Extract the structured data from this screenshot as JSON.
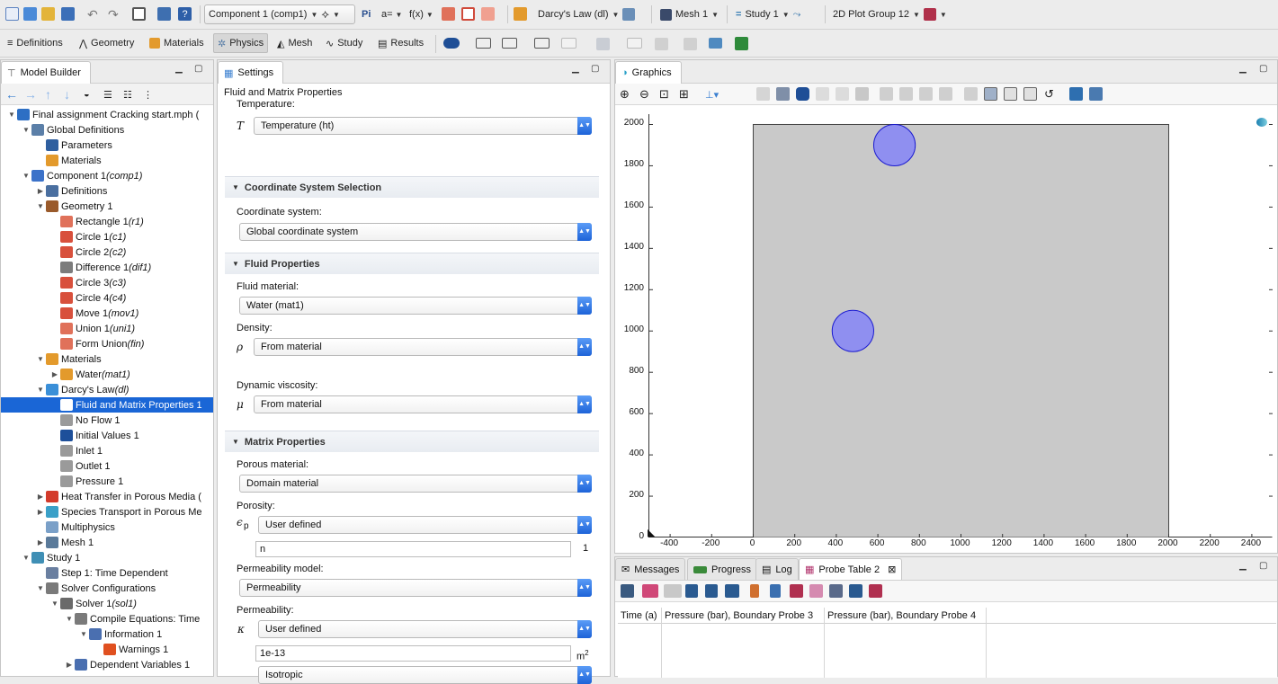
{
  "toolbar": {
    "component_combo": "Component 1 (comp1)",
    "param_label": "Pi",
    "aeq_label": "a=",
    "fx_label": "f(x)",
    "physics_combo": "Darcy's Law (dl)",
    "mesh_combo": "Mesh 1",
    "study_combo": "Study 1",
    "plot_combo": "2D Plot Group 12"
  },
  "ribbon": {
    "tabs": [
      "Definitions",
      "Geometry",
      "Materials",
      "Physics",
      "Mesh",
      "Study",
      "Results"
    ],
    "active_tab": "Physics"
  },
  "model_builder": {
    "title": "Model Builder",
    "tree": [
      {
        "label": "Final assignment Cracking start.mph (",
        "tag": "",
        "level": 0,
        "tw": "▼",
        "icon": "#2d6fc4"
      },
      {
        "label": "Global Definitions",
        "tag": "",
        "level": 1,
        "tw": "▼",
        "icon": "#5b7fa8"
      },
      {
        "label": "Parameters",
        "tag": "",
        "level": 2,
        "tw": "",
        "icon": "#2f5f9f"
      },
      {
        "label": "Materials",
        "tag": "",
        "level": 2,
        "tw": "",
        "icon": "#e39a2c"
      },
      {
        "label": "Component 1 ",
        "tag": "(comp1)",
        "level": 1,
        "tw": "▼",
        "icon": "#3b72c9"
      },
      {
        "label": "Definitions",
        "tag": "",
        "level": 2,
        "tw": "▶",
        "icon": "#4a6fa0"
      },
      {
        "label": "Geometry 1",
        "tag": "",
        "level": 2,
        "tw": "▼",
        "icon": "#9a5a2b"
      },
      {
        "label": "Rectangle 1 ",
        "tag": "(r1)",
        "level": 3,
        "tw": "",
        "icon": "#e0715a"
      },
      {
        "label": "Circle 1 ",
        "tag": "(c1)",
        "level": 3,
        "tw": "",
        "icon": "#d8503c"
      },
      {
        "label": "Circle 2 ",
        "tag": "(c2)",
        "level": 3,
        "tw": "",
        "icon": "#d8503c"
      },
      {
        "label": "Difference 1 ",
        "tag": "(dif1)",
        "level": 3,
        "tw": "",
        "icon": "#7c7c7c"
      },
      {
        "label": "Circle 3 ",
        "tag": "(c3)",
        "level": 3,
        "tw": "",
        "icon": "#d8503c"
      },
      {
        "label": "Circle 4 ",
        "tag": "(c4)",
        "level": 3,
        "tw": "",
        "icon": "#d8503c"
      },
      {
        "label": "Move 1 ",
        "tag": "(mov1)",
        "level": 3,
        "tw": "",
        "icon": "#d8503c"
      },
      {
        "label": "Union 1 ",
        "tag": "(uni1)",
        "level": 3,
        "tw": "",
        "icon": "#e0715a"
      },
      {
        "label": "Form Union ",
        "tag": "(fin)",
        "level": 3,
        "tw": "",
        "icon": "#e0715a"
      },
      {
        "label": "Materials",
        "tag": "",
        "level": 2,
        "tw": "▼",
        "icon": "#e39a2c"
      },
      {
        "label": "Water ",
        "tag": "(mat1)",
        "level": 3,
        "tw": "▶",
        "icon": "#e39a2c"
      },
      {
        "label": "Darcy's Law ",
        "tag": "(dl)",
        "level": 2,
        "tw": "▼",
        "icon": "#3a8fd8"
      },
      {
        "label": "Fluid and Matrix Properties 1",
        "tag": "",
        "level": 3,
        "tw": "",
        "icon": "#ffffff",
        "selected": true
      },
      {
        "label": "No Flow 1",
        "tag": "",
        "level": 3,
        "tw": "",
        "icon": "#9a9a9a"
      },
      {
        "label": "Initial Values 1",
        "tag": "",
        "level": 3,
        "tw": "",
        "icon": "#1d4f9a"
      },
      {
        "label": "Inlet 1",
        "tag": "",
        "level": 3,
        "tw": "",
        "icon": "#9a9a9a"
      },
      {
        "label": "Outlet 1",
        "tag": "",
        "level": 3,
        "tw": "",
        "icon": "#9a9a9a"
      },
      {
        "label": "Pressure 1",
        "tag": "",
        "level": 3,
        "tw": "",
        "icon": "#9a9a9a"
      },
      {
        "label": "Heat Transfer in Porous Media (",
        "tag": "",
        "level": 2,
        "tw": "▶",
        "icon": "#d33b2b"
      },
      {
        "label": "Species Transport in Porous Me",
        "tag": "",
        "level": 2,
        "tw": "▶",
        "icon": "#3aa0c8"
      },
      {
        "label": "Multiphysics",
        "tag": "",
        "level": 2,
        "tw": "",
        "icon": "#7aa0c8"
      },
      {
        "label": "Mesh 1",
        "tag": "",
        "level": 2,
        "tw": "▶",
        "icon": "#5a7a9a"
      },
      {
        "label": "Study 1",
        "tag": "",
        "level": 1,
        "tw": "▼",
        "icon": "#3f8fb5"
      },
      {
        "label": "Step 1: Time Dependent",
        "tag": "",
        "level": 2,
        "tw": "",
        "icon": "#6a7fa0"
      },
      {
        "label": "Solver Configurations",
        "tag": "",
        "level": 2,
        "tw": "▼",
        "icon": "#7a7a7a"
      },
      {
        "label": "Solver 1 ",
        "tag": "(sol1)",
        "level": 3,
        "tw": "▼",
        "icon": "#6a6a6a"
      },
      {
        "label": "Compile Equations: Time",
        "tag": "",
        "level": 4,
        "tw": "▼",
        "icon": "#7a7a7a"
      },
      {
        "label": "Information 1",
        "tag": "",
        "level": 5,
        "tw": "▼",
        "icon": "#4a6fb0"
      },
      {
        "label": "Warnings 1",
        "tag": "",
        "level": 6,
        "tw": "",
        "icon": "#e05020"
      },
      {
        "label": "Dependent Variables 1",
        "tag": "",
        "level": 4,
        "tw": "▶",
        "icon": "#4a6fb0"
      }
    ]
  },
  "settings": {
    "title": "Settings",
    "heading": "Fluid and Matrix Properties",
    "temperature_label": "Temperature:",
    "temperature_sym": "T",
    "temperature_value": "Temperature (ht)",
    "coord_section": "Coordinate System Selection",
    "coord_label": "Coordinate system:",
    "coord_value": "Global coordinate system",
    "fluid_section": "Fluid Properties",
    "fluid_material_label": "Fluid material:",
    "fluid_material_value": "Water (mat1)",
    "density_label": "Density:",
    "density_sym": "ρ",
    "density_value": "From material",
    "viscosity_label": "Dynamic viscosity:",
    "viscosity_sym": "μ",
    "viscosity_value": "From material",
    "matrix_section": "Matrix Properties",
    "porous_label": "Porous material:",
    "porous_value": "Domain material",
    "porosity_label": "Porosity:",
    "porosity_sym": "ϵ",
    "porosity_sub": "p",
    "porosity_value": "User defined",
    "porosity_field": "n",
    "porosity_unit": "1",
    "perm_model_label": "Permeability model:",
    "perm_model_value": "Permeability",
    "perm_label": "Permeability:",
    "perm_sym": "κ",
    "perm_value": "User defined",
    "perm_field": "1e-13",
    "perm_unit": "m",
    "perm_unit_sup": "2",
    "perm_iso_value": "Isotropic"
  },
  "graphics": {
    "title": "Graphics",
    "chart_data": {
      "type": "scatter",
      "title": "",
      "xlabel": "",
      "ylabel": "",
      "xlim": [
        -500,
        2500
      ],
      "ylim": [
        0,
        2050
      ],
      "x_ticks": [
        -400,
        -200,
        0,
        200,
        400,
        600,
        800,
        1000,
        1200,
        1400,
        1600,
        1800,
        2000,
        2200,
        2400
      ],
      "y_ticks": [
        0,
        200,
        400,
        600,
        800,
        1000,
        1200,
        1400,
        1600,
        1800,
        2000
      ],
      "domain_rect": {
        "x0": 0,
        "y0": 0,
        "x1": 2000,
        "y1": 2000,
        "color": "#c9c9c9"
      },
      "circles": [
        {
          "cx": 680,
          "cy": 1900,
          "r": 100,
          "color": "#8f8ff0"
        },
        {
          "cx": 480,
          "cy": 1000,
          "r": 100,
          "color": "#8f8ff0"
        }
      ]
    }
  },
  "bottom": {
    "tabs": [
      "Messages",
      "Progress",
      "Log",
      "Probe Table 2"
    ],
    "active_tab": "Probe Table 2",
    "columns": [
      "Time (a)",
      "Pressure (bar), Boundary Probe 3",
      "Pressure (bar), Boundary Probe 4"
    ]
  }
}
